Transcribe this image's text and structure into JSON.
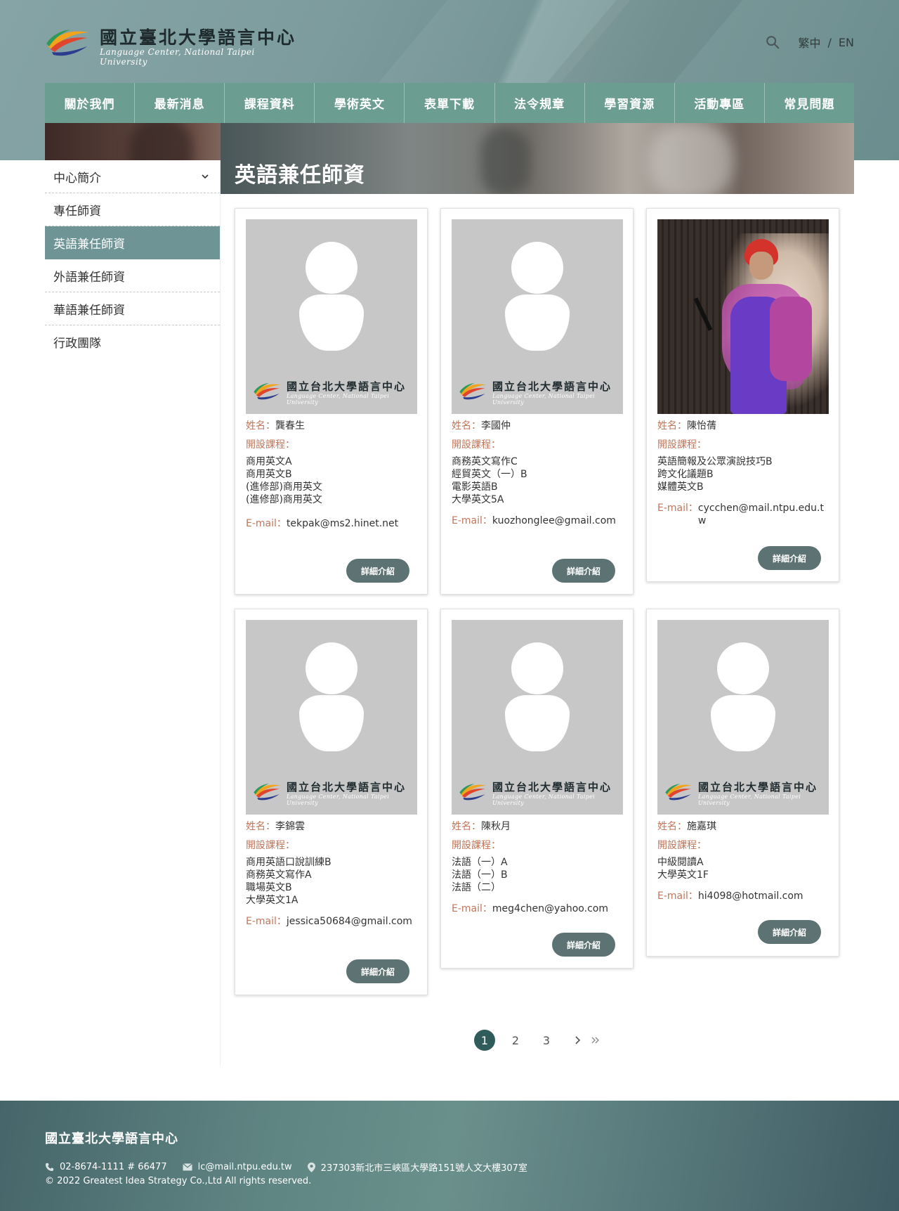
{
  "header": {
    "logo_title": "國立臺北大學語言中心",
    "logo_subtitle": "Language Center, National Taipei University",
    "lang_zh": "繁中",
    "lang_sep": "/",
    "lang_en": "EN",
    "search_icon": "search-icon"
  },
  "nav": {
    "items": [
      "關於我們",
      "最新消息",
      "課程資料",
      "學術英文",
      "表單下載",
      "法令規章",
      "學習資源",
      "活動專區",
      "常見問題"
    ]
  },
  "page": {
    "title": "英語兼任師資"
  },
  "sidebar": {
    "head": "中心簡介",
    "items": [
      "專任師資",
      "英語兼任師資",
      "外語兼任師資",
      "華語兼任師資",
      "行政團隊"
    ],
    "active_index": 1
  },
  "card_labels": {
    "name": "姓名：",
    "courses": "開設課程：",
    "email": "E-mail：",
    "detail_button": "詳細介紹"
  },
  "photo_logo": {
    "title": "國立台北大學語言中心",
    "subtitle": "Language Center, National Taipei University"
  },
  "teachers": [
    {
      "name": "龔春生",
      "courses": [
        "商用英文A",
        "商用英文B",
        "(進修部)商用英文",
        "(進修部)商用英文"
      ],
      "email": "tekpak@ms2.hinet.net",
      "photo": "placeholder"
    },
    {
      "name": "李國仲",
      "courses": [
        "商務英文寫作C",
        "經貿英文（一）B",
        "電影英語B",
        "大學英文5A"
      ],
      "email": "kuozhonglee@gmail.com",
      "photo": "placeholder"
    },
    {
      "name": "陳怡蒨",
      "courses": [
        "英語簡報及公眾演說技巧B",
        "跨文化議題B",
        "媒體英文B"
      ],
      "email": "cycchen@mail.ntpu.edu.tw",
      "photo": "photo"
    },
    {
      "name": "李錦雲",
      "courses": [
        "商用英語口說訓練B",
        "商務英文寫作A",
        "職場英文B",
        "大學英文1A"
      ],
      "email": "jessica50684@gmail.com",
      "photo": "placeholder"
    },
    {
      "name": "陳秋月",
      "courses": [
        "法語（一）A",
        "法語（一）B",
        "法語（二）"
      ],
      "email": "meg4chen@yahoo.com",
      "photo": "placeholder"
    },
    {
      "name": "施嘉琪",
      "courses": [
        "中級閱讀A",
        "大學英文1F"
      ],
      "email": "hi4098@hotmail.com",
      "photo": "placeholder"
    }
  ],
  "pagination": {
    "pages": [
      "1",
      "2",
      "3"
    ],
    "current": "1",
    "next_icon": "chevron-right-icon",
    "last_icon": "double-chevron-right-icon"
  },
  "footer": {
    "title": "國立臺北大學語言中心",
    "phone": "02-8674-1111 # 66477",
    "email": "lc@mail.ntpu.edu.tw",
    "address": "237303新北市三峽區大學路151號人文大樓307室",
    "copyright": "© 2022 Greatest Idea Strategy Co.,Ltd All rights reserved."
  },
  "colors": {
    "nav_bg": "#6b9d90",
    "sidebar_active": "#6e9496",
    "label_accent": "#c0765a",
    "button_bg": "#5d7373",
    "pager_active": "#2f5c5b"
  }
}
